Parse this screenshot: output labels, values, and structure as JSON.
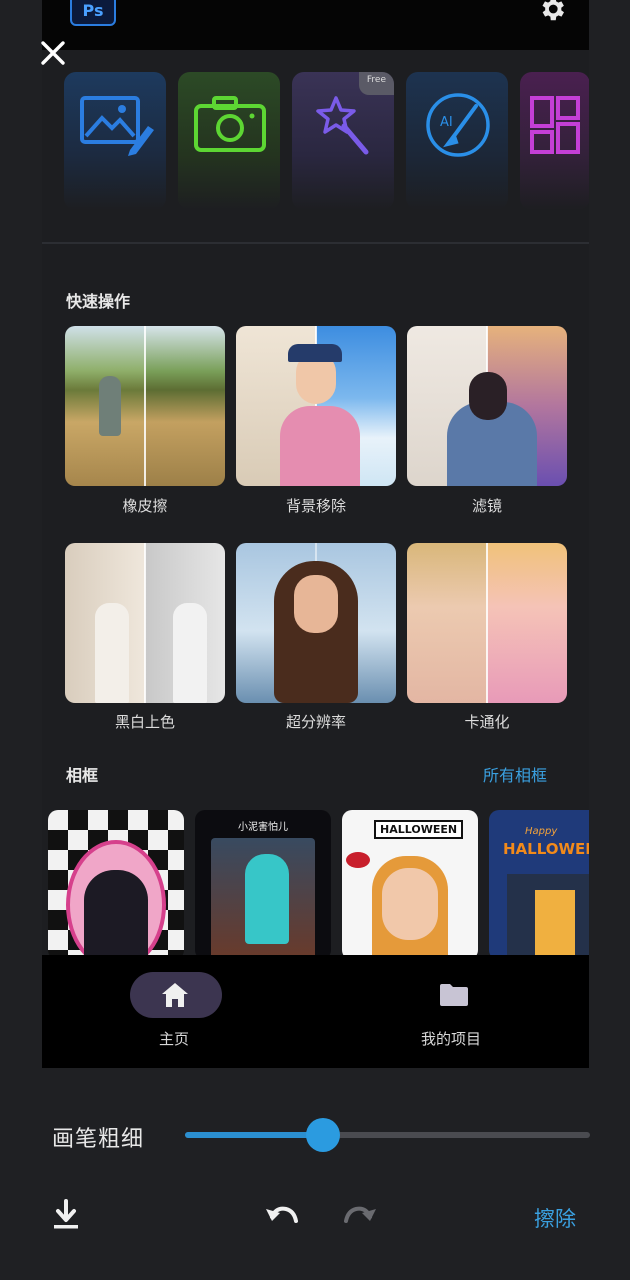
{
  "app": {
    "logo_text": "Ps"
  },
  "tools": [
    {
      "icon": "image-edit-icon",
      "color": "#2b7de0"
    },
    {
      "icon": "camera-icon",
      "color": "#5dd633"
    },
    {
      "icon": "magic-wand-icon",
      "color": "#7a5be8",
      "badge": "Free"
    },
    {
      "icon": "ai-brush-icon",
      "color": "#2a8fe8"
    },
    {
      "icon": "layout-grid-icon",
      "color": "#c43fd6"
    }
  ],
  "quick_actions": {
    "title": "快速操作",
    "items": [
      {
        "label": "橡皮擦"
      },
      {
        "label": "背景移除"
      },
      {
        "label": "滤镜"
      },
      {
        "label": "黑白上色"
      },
      {
        "label": "超分辨率"
      },
      {
        "label": "卡通化"
      }
    ]
  },
  "frames": {
    "title": "相框",
    "all_link": "所有相框",
    "items": [
      {
        "caption": ""
      },
      {
        "caption": "小泥害怕儿"
      },
      {
        "caption": "HALLOWEEN"
      },
      {
        "caption": "HALLOWEEN"
      },
      {
        "caption": "Happy"
      }
    ]
  },
  "nav": {
    "home": "主页",
    "projects": "我的项目"
  },
  "brush": {
    "label": "画笔粗细",
    "value_fraction": 0.34
  },
  "bottom": {
    "erase_label": "擦除"
  },
  "colors": {
    "accent": "#2b9be0",
    "background": "#1f2023"
  }
}
